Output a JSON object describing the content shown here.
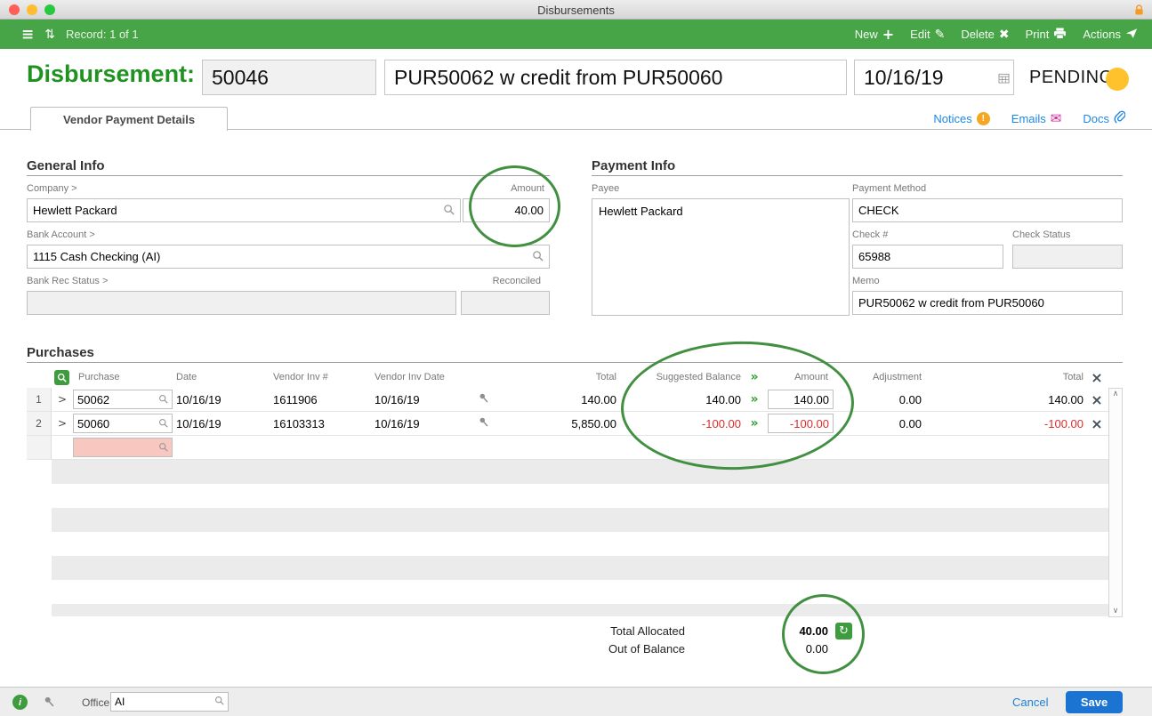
{
  "window": {
    "title": "Disbursements"
  },
  "toolbar": {
    "record": "Record: 1 of 1",
    "new": "New",
    "edit": "Edit",
    "delete": "Delete",
    "print": "Print",
    "actions": "Actions"
  },
  "header": {
    "title": "Disbursement:",
    "record_number": "50046",
    "description": "PUR50062 w credit from PUR50060",
    "date": "10/16/19",
    "status": "PENDING"
  },
  "tab_bar": {
    "active_tab": "Vendor Payment Details",
    "notices": "Notices",
    "emails": "Emails",
    "docs": "Docs"
  },
  "general_info": {
    "heading": "General Info",
    "company_label": "Company >",
    "company": "Hewlett Packard",
    "amount_label": "Amount",
    "amount": "40.00",
    "bank_account_label": "Bank Account >",
    "bank_account": "1115 Cash Checking (AI)",
    "bank_rec_status_label": "Bank Rec Status >",
    "bank_rec_status": "",
    "reconciled_label": "Reconciled",
    "reconciled": ""
  },
  "payment_info": {
    "heading": "Payment Info",
    "payee_label": "Payee",
    "payee": "Hewlett Packard",
    "payment_method_label": "Payment Method",
    "payment_method": "CHECK",
    "check_number_label": "Check #",
    "check_number": "65988",
    "check_status_label": "Check Status",
    "check_status": "",
    "memo_label": "Memo",
    "memo": "PUR50062 w credit from PUR50060"
  },
  "purchases": {
    "heading": "Purchases",
    "columns": [
      "Purchase",
      "Date",
      "Vendor Inv #",
      "Vendor Inv Date",
      "Total",
      "Suggested Balance",
      "Amount",
      "Adjustment",
      "Total"
    ],
    "rows": [
      {
        "num": "1",
        "purchase": "50062",
        "date": "10/16/19",
        "vendor_inv": "1611906",
        "vendor_inv_date": "10/16/19",
        "total": "140.00",
        "suggested_balance": "140.00",
        "amount": "140.00",
        "adjustment": "0.00",
        "row_total": "140.00"
      },
      {
        "num": "2",
        "purchase": "50060",
        "date": "10/16/19",
        "vendor_inv": "16103313",
        "vendor_inv_date": "10/16/19",
        "total": "5,850.00",
        "suggested_balance": "-100.00",
        "amount": "-100.00",
        "adjustment": "0.00",
        "row_total": "-100.00"
      }
    ],
    "new_row_purchase": "",
    "total_allocated_label": "Total Allocated",
    "total_allocated": "40.00",
    "out_of_balance_label": "Out of Balance",
    "out_of_balance": "0.00"
  },
  "footer": {
    "office_label": "Office",
    "office": "AI",
    "cancel": "Cancel",
    "save": "Save"
  },
  "icons": {
    "hamburger": "≡",
    "record_stepper": "⇅",
    "new_plus": "+",
    "edit_pencil": "✎",
    "delete_x": "✖",
    "chevron_right": ">",
    "double_chevron": "»",
    "remove_x": "×",
    "refresh": "↻",
    "notices_badge": "!",
    "envelope": "✉",
    "info": "i",
    "scroll_up": "∧",
    "scroll_down": "∨"
  },
  "colors": {
    "toolbar_green": "#47A447",
    "title_green": "#1F9220",
    "status_amber": "#FFC22C",
    "link_blue": "#1E88E5",
    "save_blue": "#1B74D2",
    "negative_red": "#E02B2B",
    "annotation_green": "#418F41",
    "emails_magenta": "#D6219C",
    "notices_orange": "#F5A623"
  }
}
